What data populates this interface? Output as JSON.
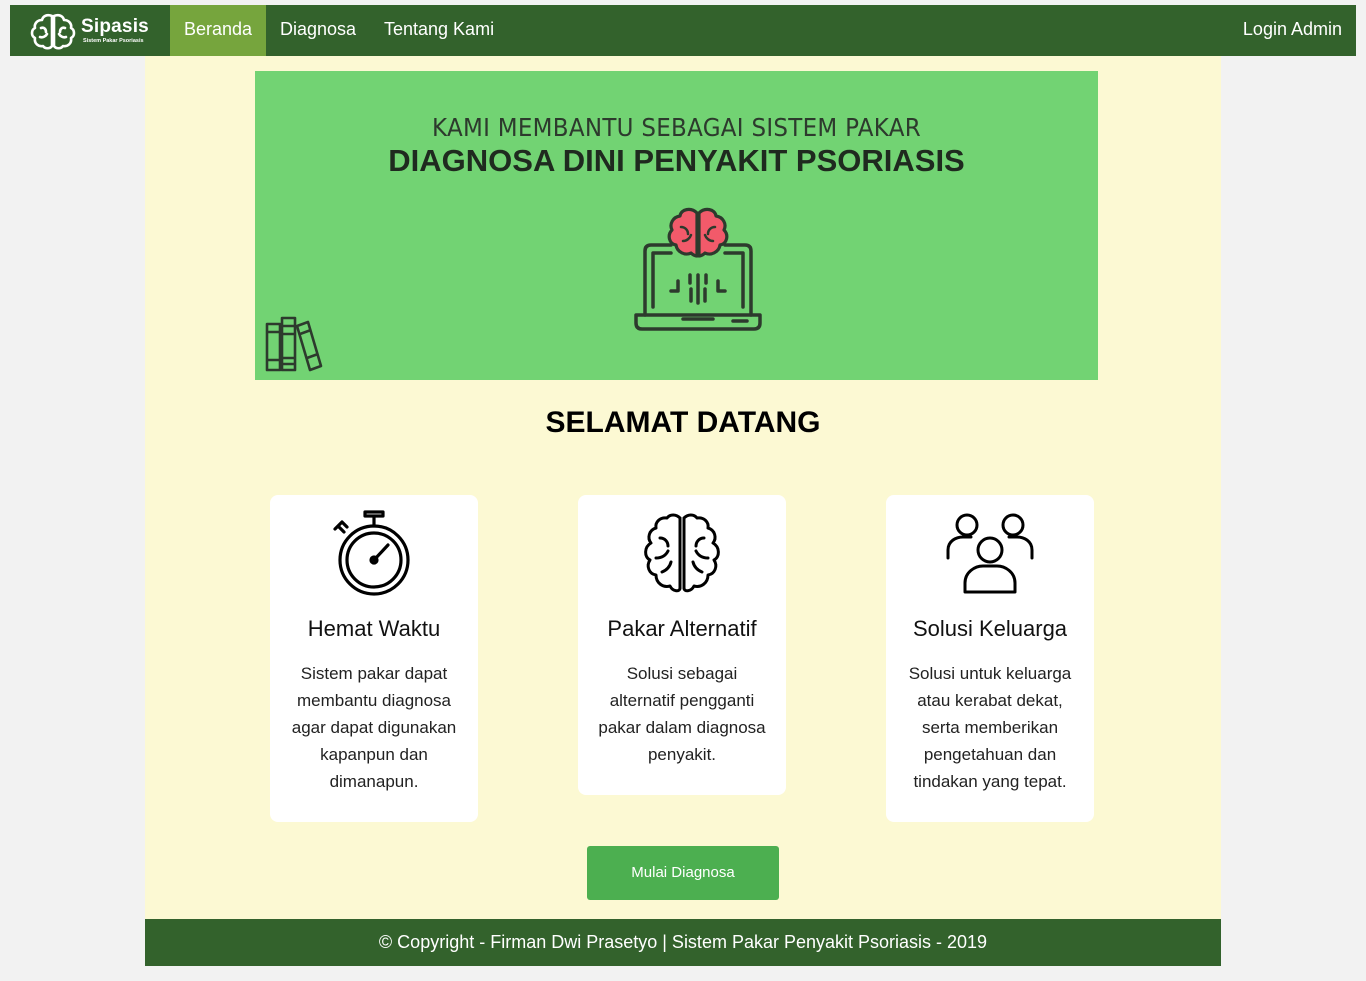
{
  "brand": {
    "name": "Sipasis",
    "subtitle": "Sistem Pakar Psoriasis"
  },
  "nav": {
    "items": [
      {
        "label": "Beranda",
        "active": true
      },
      {
        "label": "Diagnosa",
        "active": false
      },
      {
        "label": "Tentang Kami",
        "active": false
      }
    ],
    "login_label": "Login Admin"
  },
  "hero": {
    "line1": "KAMI MEMBANTU SEBAGAI SISTEM PAKAR",
    "line2": "DIAGNOSA DINI PENYAKIT PSORIASIS",
    "icons": [
      "brain-laptop-icon",
      "books-icon"
    ]
  },
  "welcome": "SELAMAT DATANG",
  "cards": [
    {
      "icon": "stopwatch-icon",
      "title": "Hemat Waktu",
      "desc": "Sistem pakar dapat membantu diagnosa agar dapat digunakan kapanpun dan dimanapun."
    },
    {
      "icon": "brain-icon",
      "title": "Pakar Alternatif",
      "desc": "Solusi sebagai alternatif pengganti pakar dalam diagnosa penyakit."
    },
    {
      "icon": "users-icon",
      "title": "Solusi Keluarga",
      "desc": "Solusi untuk keluarga atau kerabat dekat, serta memberikan pengetahuan dan tindakan yang tepat."
    }
  ],
  "cta_label": "Mulai Diagnosa",
  "footer": "© Copyright - Firman Dwi Prasetyo | Sistem Pakar Penyakit Psoriasis - 2019",
  "colors": {
    "nav": "#33622c",
    "nav_active": "#76a53d",
    "hero": "#72d373",
    "page_bg": "#fcf9d3",
    "button": "#4caf50"
  }
}
